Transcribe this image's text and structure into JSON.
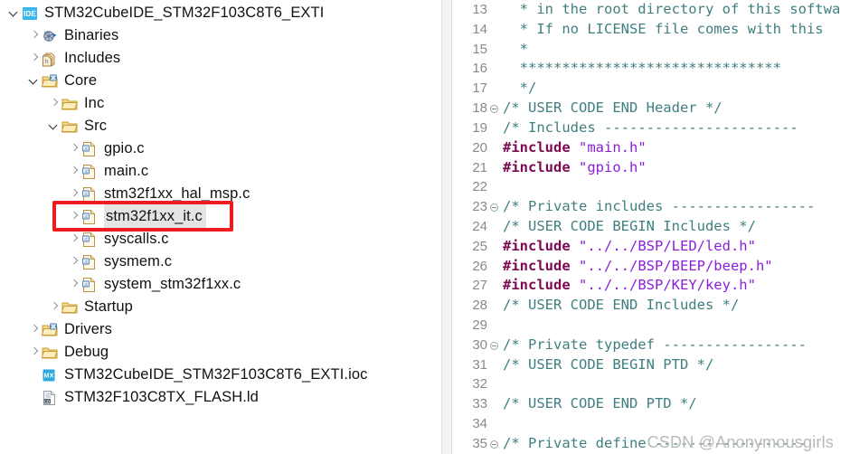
{
  "explorer": {
    "name": "project-explorer",
    "tree": [
      {
        "label": "STM32CubeIDE_STM32F103C8T6_EXTI",
        "icon": "ide-project-icon",
        "indent": 0,
        "arrow": "down",
        "selected": false
      },
      {
        "label": "Binaries",
        "icon": "binaries-icon",
        "indent": 1,
        "arrow": "right",
        "selected": false
      },
      {
        "label": "Includes",
        "icon": "includes-icon",
        "indent": 1,
        "arrow": "right",
        "selected": false
      },
      {
        "label": "Core",
        "icon": "source-folder-icon",
        "indent": 1,
        "arrow": "down",
        "selected": false
      },
      {
        "label": "Inc",
        "icon": "folder-icon",
        "indent": 2,
        "arrow": "right",
        "selected": false
      },
      {
        "label": "Src",
        "icon": "folder-icon",
        "indent": 2,
        "arrow": "down",
        "selected": false
      },
      {
        "label": "gpio.c",
        "icon": "c-file-icon",
        "indent": 3,
        "arrow": "right",
        "selected": false
      },
      {
        "label": "main.c",
        "icon": "c-file-icon",
        "indent": 3,
        "arrow": "right",
        "selected": false
      },
      {
        "label": "stm32f1xx_hal_msp.c",
        "icon": "c-file-icon",
        "indent": 3,
        "arrow": "right",
        "selected": false
      },
      {
        "label": "stm32f1xx_it.c",
        "icon": "c-file-icon",
        "indent": 3,
        "arrow": "right",
        "selected": true
      },
      {
        "label": "syscalls.c",
        "icon": "c-file-icon",
        "indent": 3,
        "arrow": "right",
        "selected": false
      },
      {
        "label": "sysmem.c",
        "icon": "c-file-icon",
        "indent": 3,
        "arrow": "right",
        "selected": false
      },
      {
        "label": "system_stm32f1xx.c",
        "icon": "c-file-icon",
        "indent": 3,
        "arrow": "right",
        "selected": false
      },
      {
        "label": "Startup",
        "icon": "folder-icon",
        "indent": 2,
        "arrow": "right",
        "selected": false
      },
      {
        "label": "Drivers",
        "icon": "source-folder-icon",
        "indent": 1,
        "arrow": "right",
        "selected": false
      },
      {
        "label": "Debug",
        "icon": "folder-icon",
        "indent": 1,
        "arrow": "right",
        "selected": false
      },
      {
        "label": "STM32CubeIDE_STM32F103C8T6_EXTI.ioc",
        "icon": "ioc-file-icon",
        "indent": 1,
        "arrow": "none",
        "selected": false
      },
      {
        "label": "STM32F103C8TX_FLASH.ld",
        "icon": "ld-file-icon",
        "indent": 1,
        "arrow": "none",
        "selected": false
      }
    ]
  },
  "editor": {
    "name": "code-editor",
    "lines": [
      {
        "num": "13",
        "fold": false,
        "tokens": [
          {
            "t": "  * in the root directory of this softwa",
            "c": "cmt"
          }
        ]
      },
      {
        "num": "14",
        "fold": false,
        "tokens": [
          {
            "t": "  * If no LICENSE file comes with this ",
            "c": "cmt"
          }
        ]
      },
      {
        "num": "15",
        "fold": false,
        "tokens": [
          {
            "t": "  *",
            "c": "cmt"
          }
        ]
      },
      {
        "num": "16",
        "fold": false,
        "tokens": [
          {
            "t": "  *******************************",
            "c": "cmt"
          }
        ]
      },
      {
        "num": "17",
        "fold": false,
        "tokens": [
          {
            "t": "  */",
            "c": "cmt"
          }
        ]
      },
      {
        "num": "18",
        "fold": true,
        "tokens": [
          {
            "t": "/* USER CODE END Header */",
            "c": "cmt"
          }
        ]
      },
      {
        "num": "19",
        "fold": false,
        "tokens": [
          {
            "t": "/* Includes -----------------------",
            "c": "cmt"
          }
        ]
      },
      {
        "num": "20",
        "fold": false,
        "tokens": [
          {
            "t": "#include ",
            "c": "pp"
          },
          {
            "t": "\"main.h\"",
            "c": "str"
          }
        ]
      },
      {
        "num": "21",
        "fold": false,
        "tokens": [
          {
            "t": "#include ",
            "c": "pp"
          },
          {
            "t": "\"gpio.h\"",
            "c": "str"
          }
        ]
      },
      {
        "num": "22",
        "fold": false,
        "tokens": [
          {
            "t": "",
            "c": "plain"
          }
        ]
      },
      {
        "num": "23",
        "fold": true,
        "tokens": [
          {
            "t": "/* Private includes -----------------",
            "c": "cmt"
          }
        ]
      },
      {
        "num": "24",
        "fold": false,
        "tokens": [
          {
            "t": "/* USER CODE BEGIN Includes */",
            "c": "cmt"
          }
        ]
      },
      {
        "num": "25",
        "fold": false,
        "tokens": [
          {
            "t": "#include ",
            "c": "pp"
          },
          {
            "t": "\"../../BSP/LED/led.h\"",
            "c": "str"
          }
        ]
      },
      {
        "num": "26",
        "fold": false,
        "tokens": [
          {
            "t": "#include ",
            "c": "pp"
          },
          {
            "t": "\"../../BSP/BEEP/beep.h\"",
            "c": "str"
          }
        ]
      },
      {
        "num": "27",
        "fold": false,
        "tokens": [
          {
            "t": "#include ",
            "c": "pp"
          },
          {
            "t": "\"../../BSP/KEY/key.h\"",
            "c": "str"
          }
        ]
      },
      {
        "num": "28",
        "fold": false,
        "tokens": [
          {
            "t": "/* USER CODE END Includes */",
            "c": "cmt"
          }
        ]
      },
      {
        "num": "29",
        "fold": false,
        "tokens": [
          {
            "t": "",
            "c": "plain"
          }
        ]
      },
      {
        "num": "30",
        "fold": true,
        "tokens": [
          {
            "t": "/* Private typedef -----------------",
            "c": "cmt"
          }
        ]
      },
      {
        "num": "31",
        "fold": false,
        "tokens": [
          {
            "t": "/* USER CODE BEGIN PTD */",
            "c": "cmt"
          }
        ]
      },
      {
        "num": "32",
        "fold": false,
        "tokens": [
          {
            "t": "",
            "c": "plain"
          }
        ]
      },
      {
        "num": "33",
        "fold": false,
        "tokens": [
          {
            "t": "/* USER CODE END PTD */",
            "c": "cmt"
          }
        ]
      },
      {
        "num": "34",
        "fold": false,
        "tokens": [
          {
            "t": "",
            "c": "plain"
          }
        ]
      },
      {
        "num": "35",
        "fold": true,
        "tokens": [
          {
            "t": "/* Private define ------------------",
            "c": "cmt"
          }
        ]
      }
    ]
  },
  "annotation": {
    "name": "red-highlight-box",
    "target": "stm32f1xx_it.c",
    "color": "#ee1c20"
  },
  "watermark": {
    "text": "CSDN @Anonymousgirls"
  },
  "colors": {
    "comment": "#3f7f7f",
    "preprocessor": "#7b0a52",
    "string": "#8b1fd8",
    "selection": "#e4e4e4",
    "annotation": "#ee1c20"
  }
}
